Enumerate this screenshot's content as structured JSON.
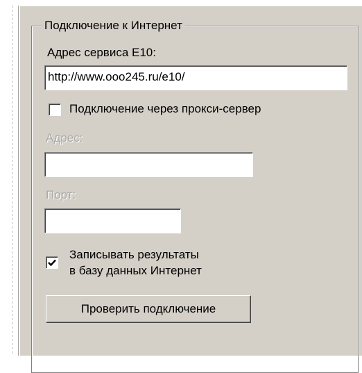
{
  "group": {
    "title": "Подключение к Интернет"
  },
  "service": {
    "label": "Адрес сервиса E10:",
    "value": "http://www.ooo245.ru/e10/"
  },
  "proxy": {
    "checkbox_label": "Подключение через прокси-сервер",
    "checked": false,
    "address_label": "Адрес:",
    "address_value": "",
    "port_label": "Порт:",
    "port_value": ""
  },
  "save_results": {
    "line1": "Записывать результаты",
    "line2": "в базу данных Интернет",
    "checked": true
  },
  "check_button": {
    "label": "Проверить подключение"
  },
  "colors": {
    "panel_bg": "#d4d0c8",
    "disabled_text": "#a8a8a8"
  }
}
